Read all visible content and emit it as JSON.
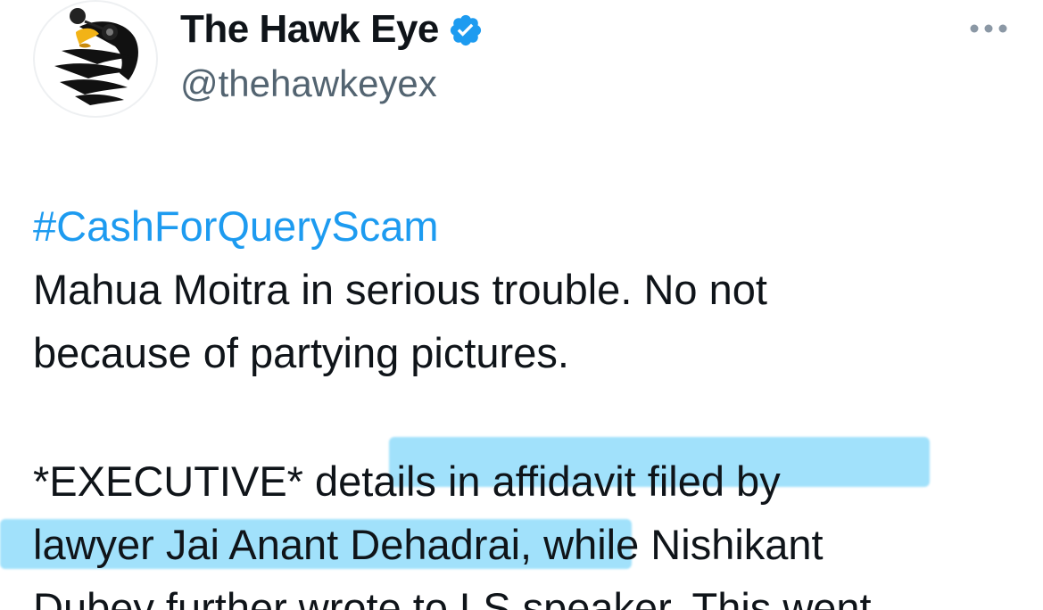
{
  "account": {
    "display_name": "The Hawk Eye",
    "handle": "@thehawkeyex",
    "verified": true,
    "verified_color": "#1d9bf0",
    "avatar_icon": "hawk-logo-icon"
  },
  "menu": {
    "more_icon": "more-horizontal-icon"
  },
  "tweet": {
    "hashtag": "#CashForQueryScam",
    "lines": [
      "Mahua Moitra in serious trouble. No not",
      "because of partying pictures.",
      "*EXECUTIVE* details in affidavit filed by",
      "lawyer Jai Anant Dehadrai, while Nishikant",
      "Dubey further wrote to LS speaker. This went"
    ]
  },
  "colors": {
    "text": "#0f1419",
    "secondary": "#536471",
    "link": "#1d9bf0",
    "highlight": "#82d7fa"
  }
}
